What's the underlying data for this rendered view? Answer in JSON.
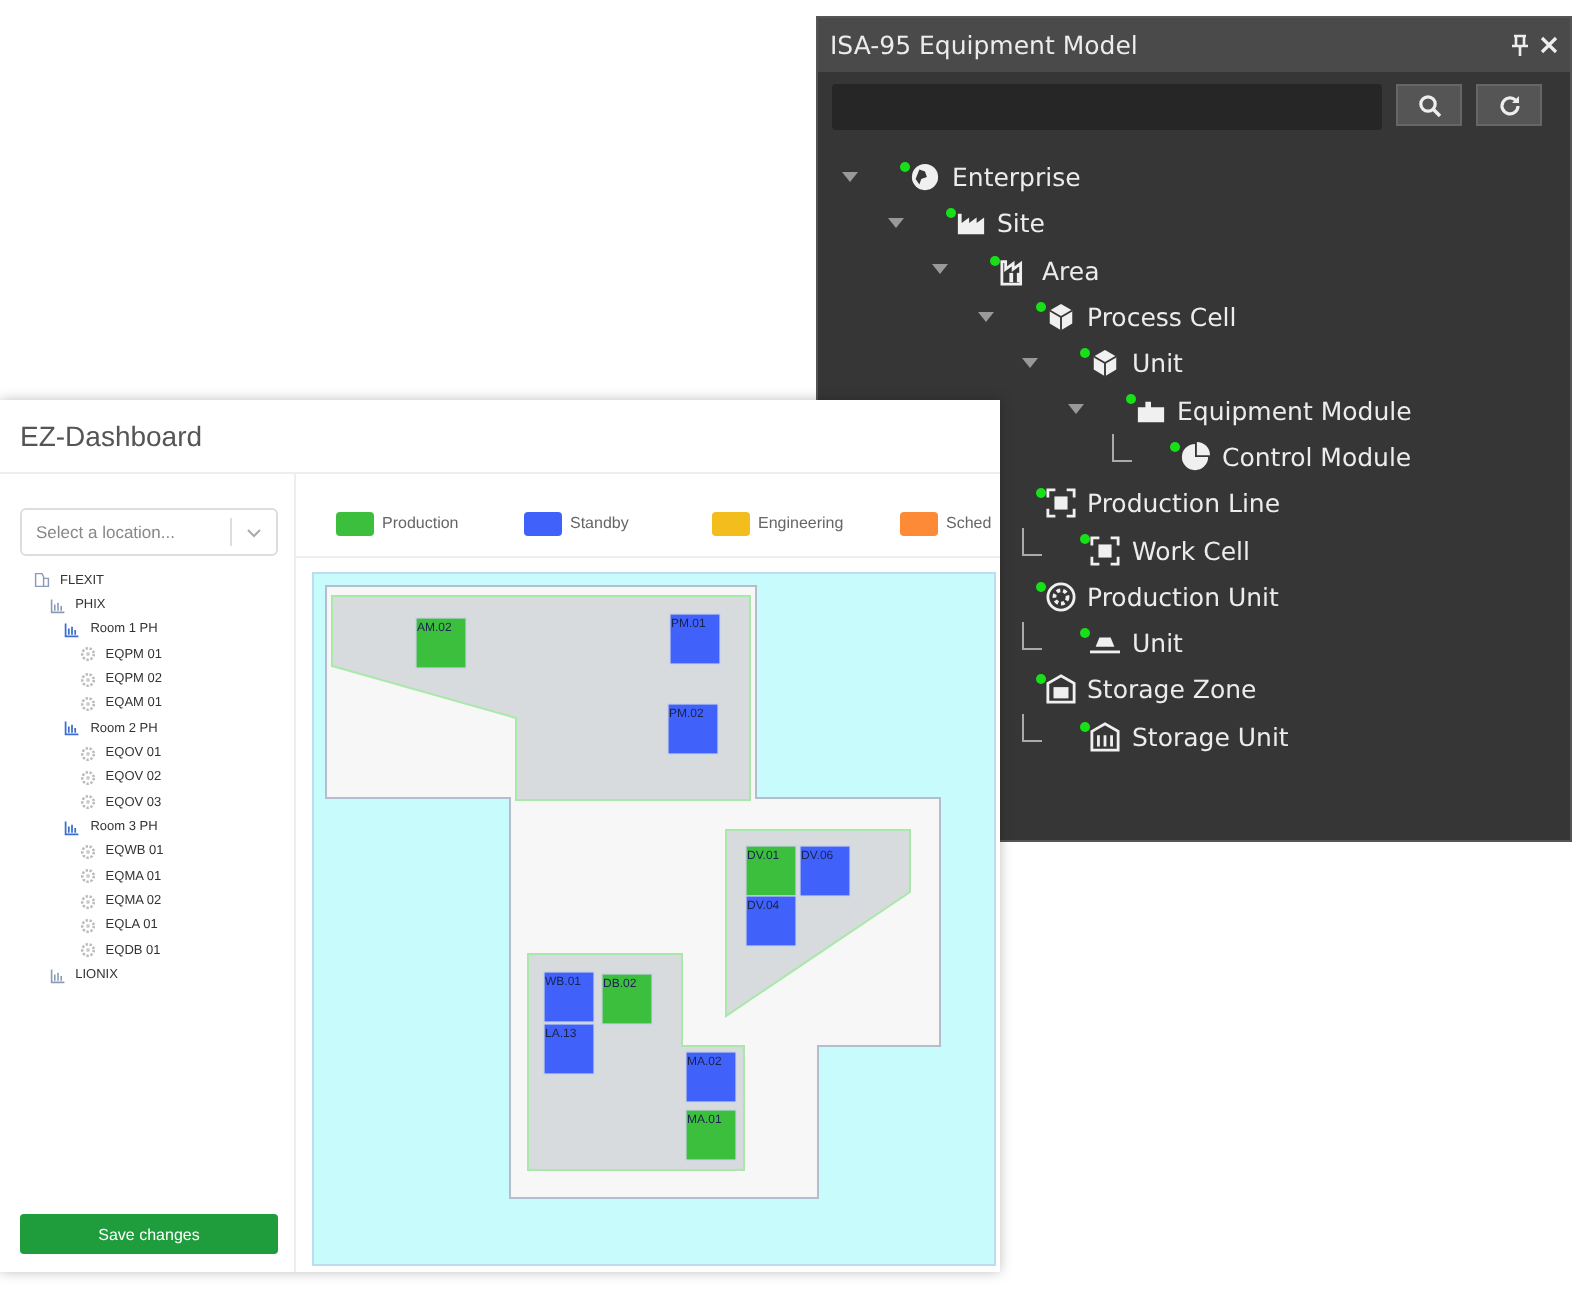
{
  "equipment_panel": {
    "title": "ISA-95 Equipment Model",
    "tree": [
      {
        "label": "Enterprise",
        "kind": "globe",
        "expanded": true,
        "children": [
          {
            "label": "Site",
            "kind": "factory",
            "expanded": true,
            "children": [
              {
                "label": "Area",
                "kind": "building",
                "expanded": true,
                "children": [
                  {
                    "label": "Process Cell",
                    "kind": "cube",
                    "expanded": true,
                    "children": [
                      {
                        "label": "Unit",
                        "kind": "cube",
                        "expanded": true,
                        "children": [
                          {
                            "label": "Equipment Module",
                            "kind": "puzzle",
                            "expanded": true,
                            "children": [
                              {
                                "label": "Control Module",
                                "kind": "pie"
                              }
                            ]
                          }
                        ]
                      }
                    ]
                  },
                  {
                    "label": "Production Line",
                    "kind": "frame",
                    "children": [
                      {
                        "label": "Work Cell",
                        "kind": "frame"
                      }
                    ]
                  },
                  {
                    "label": "Production Unit",
                    "kind": "gear",
                    "children": [
                      {
                        "label": "Unit",
                        "kind": "conveyor"
                      }
                    ]
                  },
                  {
                    "label": "Storage Zone",
                    "kind": "warehouse",
                    "children": [
                      {
                        "label": "Storage Unit",
                        "kind": "storage"
                      }
                    ]
                  }
                ]
              }
            ]
          }
        ]
      }
    ]
  },
  "dashboard": {
    "title": "EZ-Dashboard",
    "location_select": {
      "placeholder": "Select a location..."
    },
    "locations": [
      {
        "label": "FLEXIT",
        "kind": "document",
        "children": [
          {
            "label": "PHIX",
            "kind": "chart",
            "children": [
              {
                "label": "Room 1 PH",
                "kind": "room",
                "children": [
                  {
                    "label": "EQPM 01",
                    "kind": "gear"
                  },
                  {
                    "label": "EQPM 02",
                    "kind": "gear"
                  },
                  {
                    "label": "EQAM 01",
                    "kind": "gear"
                  }
                ]
              },
              {
                "label": "Room 2 PH",
                "kind": "room",
                "children": [
                  {
                    "label": "EQOV 01",
                    "kind": "gear"
                  },
                  {
                    "label": "EQOV 02",
                    "kind": "gear"
                  },
                  {
                    "label": "EQOV 03",
                    "kind": "gear"
                  }
                ]
              },
              {
                "label": "Room 3 PH",
                "kind": "room",
                "children": [
                  {
                    "label": "EQWB 01",
                    "kind": "gear"
                  },
                  {
                    "label": "EQMA 01",
                    "kind": "gear"
                  },
                  {
                    "label": "EQMA 02",
                    "kind": "gear"
                  },
                  {
                    "label": "EQLA 01",
                    "kind": "gear"
                  },
                  {
                    "label": "EQDB 01",
                    "kind": "gear"
                  }
                ]
              }
            ]
          },
          {
            "label": "LIONIX",
            "kind": "chart"
          }
        ]
      }
    ],
    "save_button": "Save changes",
    "legend": [
      {
        "label": "Production",
        "color": "#3cbf3c"
      },
      {
        "label": "Standby",
        "color": "#4062fa"
      },
      {
        "label": "Engineering",
        "color": "#f4bd1e"
      },
      {
        "label": "Sched",
        "color": "#fd8a36"
      }
    ],
    "equipment": [
      {
        "label": "AM.02",
        "color": "#3cbf3c"
      },
      {
        "label": "PM.01",
        "color": "#4062fa"
      },
      {
        "label": "PM.02",
        "color": "#4062fa"
      },
      {
        "label": "DV.01",
        "color": "#3cbf3c"
      },
      {
        "label": "DV.06",
        "color": "#4062fa"
      },
      {
        "label": "DV.04",
        "color": "#4062fa"
      },
      {
        "label": "WB.01",
        "color": "#4062fa"
      },
      {
        "label": "DB.02",
        "color": "#3cbf3c"
      },
      {
        "label": "LA.13",
        "color": "#4062fa"
      },
      {
        "label": "MA.02",
        "color": "#4062fa"
      },
      {
        "label": "MA.01",
        "color": "#3cbf3c"
      }
    ]
  }
}
